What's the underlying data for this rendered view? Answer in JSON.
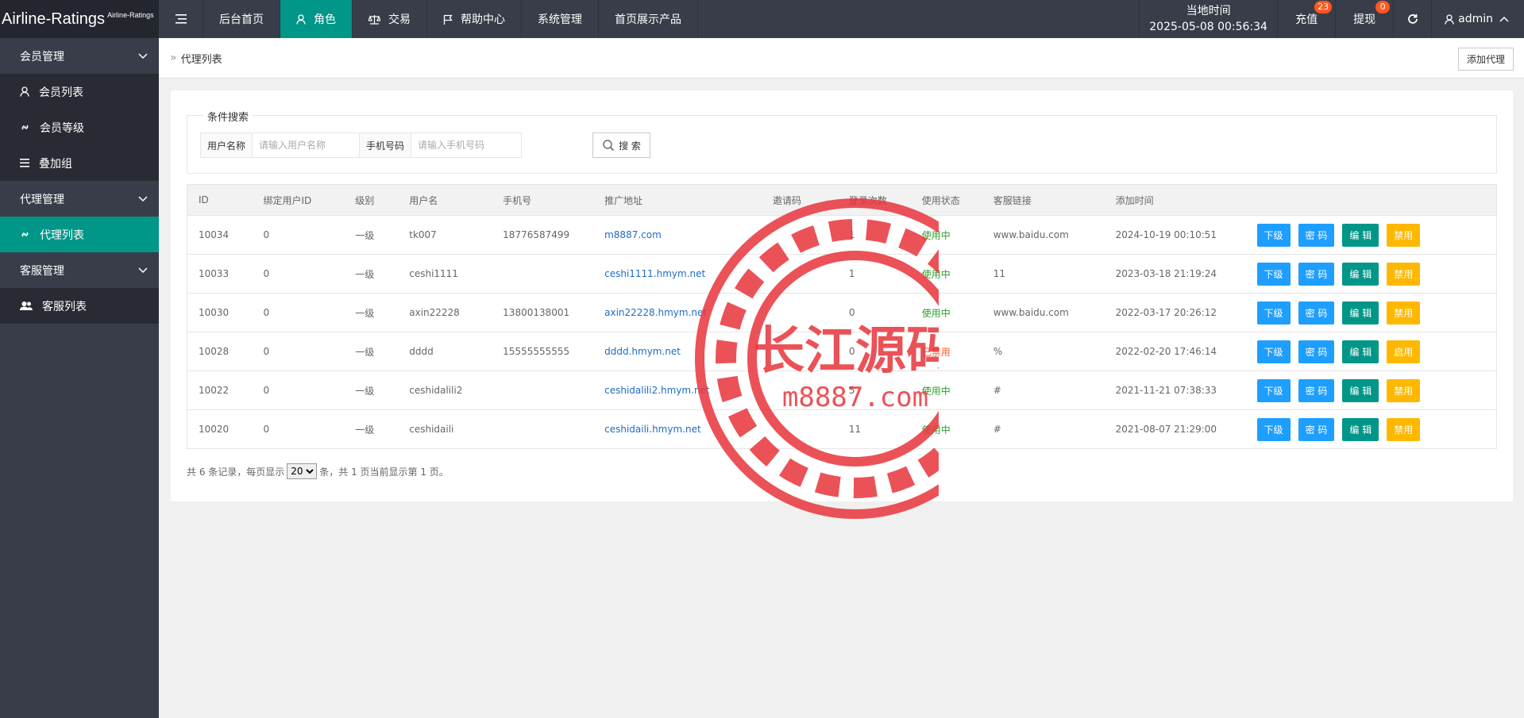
{
  "brand": {
    "title": "Airline-Ratings",
    "subtitle": "Airline-Ratings"
  },
  "nav": [
    {
      "label": "后台首页",
      "icon": "",
      "active": false
    },
    {
      "label": "角色",
      "icon": "user-icon",
      "active": true
    },
    {
      "label": "交易",
      "icon": "scale-icon",
      "active": false
    },
    {
      "label": "帮助中心",
      "icon": "flag-icon",
      "active": false
    },
    {
      "label": "系统管理",
      "icon": "",
      "active": false
    },
    {
      "label": "首页展示产品",
      "icon": "",
      "active": false
    }
  ],
  "clock": {
    "label": "当地时间",
    "value": "2025-05-08 00:56:34"
  },
  "recharge": {
    "label": "充值",
    "badge": "23"
  },
  "withdraw": {
    "label": "提现",
    "badge": "0"
  },
  "user": {
    "name": "admin"
  },
  "sidebar": {
    "groups": [
      {
        "label": "会员管理",
        "items": [
          {
            "label": "会员列表",
            "icon": "user-icon",
            "active": false
          },
          {
            "label": "会员等级",
            "icon": "link-icon",
            "active": false
          },
          {
            "label": "叠加组",
            "icon": "list-icon",
            "active": false
          }
        ]
      },
      {
        "label": "代理管理",
        "items": [
          {
            "label": "代理列表",
            "icon": "link-icon",
            "active": true
          }
        ]
      },
      {
        "label": "客服管理",
        "items": [
          {
            "label": "客服列表",
            "icon": "users-icon",
            "active": false
          }
        ]
      }
    ]
  },
  "breadcrumb": {
    "sep": "»",
    "current": "代理列表"
  },
  "add_button": "添加代理",
  "search": {
    "legend": "条件搜索",
    "username_label": "用户名称",
    "username_placeholder": "请输入用户名称",
    "phone_label": "手机号码",
    "phone_placeholder": "请输入手机号码",
    "button": "搜 索"
  },
  "table": {
    "headers": [
      "ID",
      "绑定用户ID",
      "级别",
      "用户名",
      "手机号",
      "推广地址",
      "邀请码",
      "登录次数",
      "使用状态",
      "客服链接",
      "添加时间",
      ""
    ],
    "rows": [
      {
        "id": "10034",
        "bind": "0",
        "level": "一级",
        "username": "tk007",
        "phone": "18776587499",
        "url": "m8887.com",
        "code": "",
        "logins": "1",
        "status": "使用中",
        "status_on": true,
        "service": "www.baidu.com",
        "time": "2024-10-19 00:10:51",
        "toggle": "禁用"
      },
      {
        "id": "10033",
        "bind": "0",
        "level": "一级",
        "username": "ceshi1111",
        "phone": "",
        "url": "ceshi1111.hmym.net",
        "code": "",
        "logins": "1",
        "status": "使用中",
        "status_on": true,
        "service": "11",
        "time": "2023-03-18 21:19:24",
        "toggle": "禁用"
      },
      {
        "id": "10030",
        "bind": "0",
        "level": "一级",
        "username": "axin22228",
        "phone": "13800138001",
        "url": "axin22228.hmym.net",
        "code": "",
        "logins": "0",
        "status": "使用中",
        "status_on": true,
        "service": "www.baidu.com",
        "time": "2022-03-17 20:26:12",
        "toggle": "禁用"
      },
      {
        "id": "10028",
        "bind": "0",
        "level": "一级",
        "username": "dddd",
        "phone": "15555555555",
        "url": "dddd.hmym.net",
        "code": "",
        "logins": "0",
        "status": "已禁用",
        "status_on": false,
        "service": "%",
        "time": "2022-02-20 17:46:14",
        "toggle": "启用"
      },
      {
        "id": "10022",
        "bind": "0",
        "level": "一级",
        "username": "ceshidalili2",
        "phone": "",
        "url": "ceshidalili2.hmym.net",
        "code": "",
        "logins": "5",
        "status": "使用中",
        "status_on": true,
        "service": "#",
        "time": "2021-11-21 07:38:33",
        "toggle": "禁用"
      },
      {
        "id": "10020",
        "bind": "0",
        "level": "一级",
        "username": "ceshidaili",
        "phone": "",
        "url": "ceshidaili.hmym.net",
        "code": "",
        "logins": "11",
        "status": "使用中",
        "status_on": true,
        "service": "#",
        "time": "2021-08-07 21:29:00",
        "toggle": "禁用"
      }
    ],
    "actions": {
      "sub": "下级",
      "pwd": "密 码",
      "edit": "编 辑"
    }
  },
  "pager": {
    "prefix": "共 6 条记录，每页显示",
    "page_size": "20",
    "suffix": "条，共 1 页当前显示第 1 页。"
  },
  "watermark": {
    "text": "长江源码",
    "url": "m8887.com"
  },
  "colors": {
    "accent": "#009688",
    "blue": "#1e9fff",
    "orange": "#ffb800",
    "red": "#ff5722",
    "topbar": "#393d49"
  }
}
